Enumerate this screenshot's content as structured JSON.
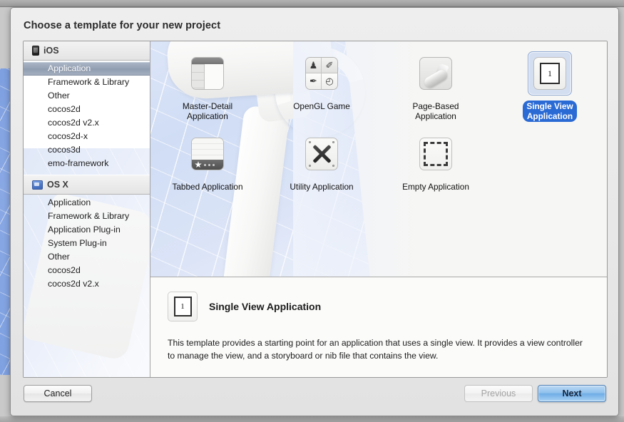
{
  "dialog": {
    "title": "Choose a template for your new project"
  },
  "sidebar": {
    "groups": [
      {
        "name": "iOS",
        "icon": "iphone-icon",
        "items": [
          {
            "label": "Application",
            "selected": true
          },
          {
            "label": "Framework & Library",
            "selected": false
          },
          {
            "label": "Other",
            "selected": false
          },
          {
            "label": "cocos2d",
            "selected": false
          },
          {
            "label": "cocos2d v2.x",
            "selected": false
          },
          {
            "label": "cocos2d-x",
            "selected": false
          },
          {
            "label": "cocos3d",
            "selected": false
          },
          {
            "label": "emo-framework",
            "selected": false
          }
        ]
      },
      {
        "name": "OS X",
        "icon": "display-icon",
        "items": [
          {
            "label": "Application",
            "selected": false
          },
          {
            "label": "Framework & Library",
            "selected": false
          },
          {
            "label": "Application Plug-in",
            "selected": false
          },
          {
            "label": "System Plug-in",
            "selected": false
          },
          {
            "label": "Other",
            "selected": false
          },
          {
            "label": "cocos2d",
            "selected": false
          },
          {
            "label": "cocos2d v2.x",
            "selected": false
          }
        ]
      }
    ]
  },
  "templates": [
    {
      "label": "Master-Detail\nApplication",
      "icon": "master-detail-icon",
      "selected": false
    },
    {
      "label": "OpenGL Game",
      "icon": "opengl-game-icon",
      "selected": false
    },
    {
      "label": "Page-Based\nApplication",
      "icon": "page-based-icon",
      "selected": false
    },
    {
      "label": "Single View\nApplication",
      "icon": "single-view-icon",
      "selected": true
    },
    {
      "label": "Tabbed Application",
      "icon": "tabbed-icon",
      "selected": false
    },
    {
      "label": "Utility Application",
      "icon": "utility-icon",
      "selected": false
    },
    {
      "label": "Empty Application",
      "icon": "empty-icon",
      "selected": false
    }
  ],
  "description": {
    "icon_number": "1",
    "title": "Single View Application",
    "body": "This template provides a starting point for an application that uses a single view. It provides a view controller to manage the view, and a storyboard or nib file that contains the view."
  },
  "single_view_icon_number": "1",
  "opengl_glyphs": [
    "♟",
    "✐",
    "✒",
    "◴"
  ],
  "footer": {
    "cancel_label": "Cancel",
    "previous_label": "Previous",
    "next_label": "Next"
  },
  "colors": {
    "selection_blue": "#2a6ad4",
    "selected_tile_bg": "#d3def1",
    "default_button_blue": "#8fc0ec",
    "sidebar_selection": "#939fb3",
    "blueprint_blue": "#89a8e4"
  }
}
